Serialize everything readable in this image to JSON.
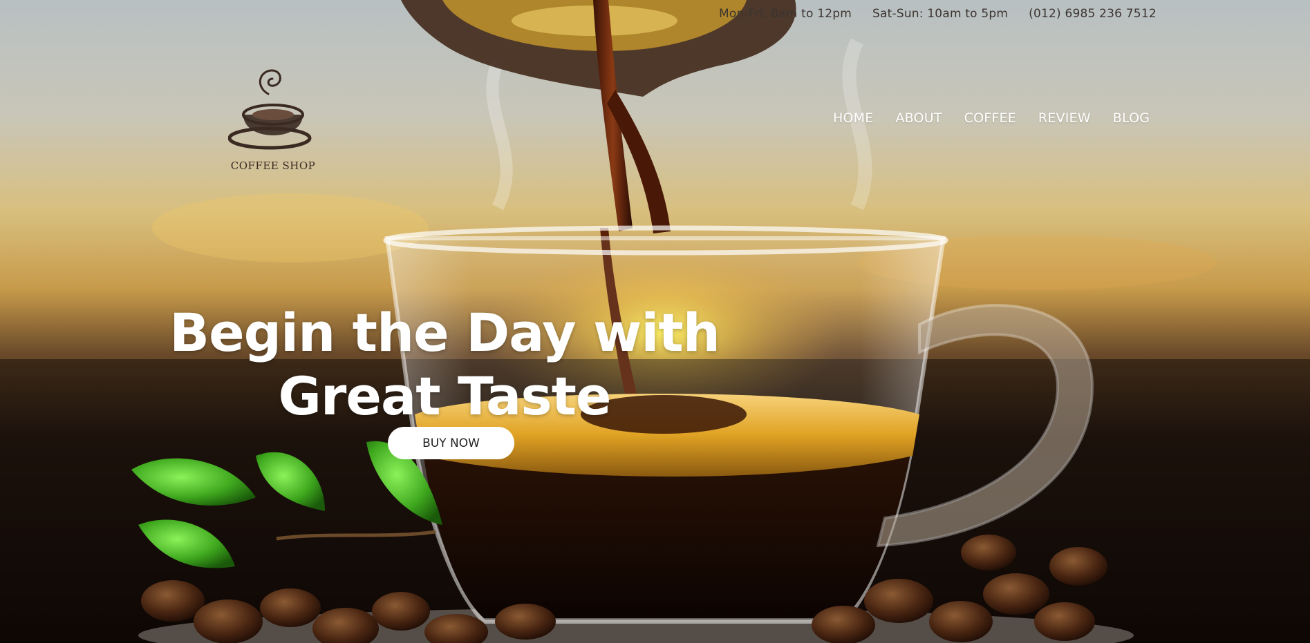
{
  "topbar": {
    "weekday_hours": "Mon-Fri: 8am to 12pm",
    "weekend_hours": "Sat-Sun: 10am to 5pm",
    "phone": "(012) 6985 236 7512"
  },
  "logo": {
    "text": "COFFEE SHOP",
    "icon": "coffee-cup-icon"
  },
  "nav": {
    "items": [
      "HOME",
      "ABOUT",
      "COFFEE",
      "REVIEW",
      "BLOG"
    ]
  },
  "hero": {
    "title_line1": "Begin the Day with",
    "title_line2": "Great Taste",
    "button_label": "BUY NOW",
    "background": "coffee-pour-photo"
  },
  "colors": {
    "logo_brown": "#3a2a22",
    "button_bg": "#ffffff",
    "heading": "#ffffff"
  }
}
